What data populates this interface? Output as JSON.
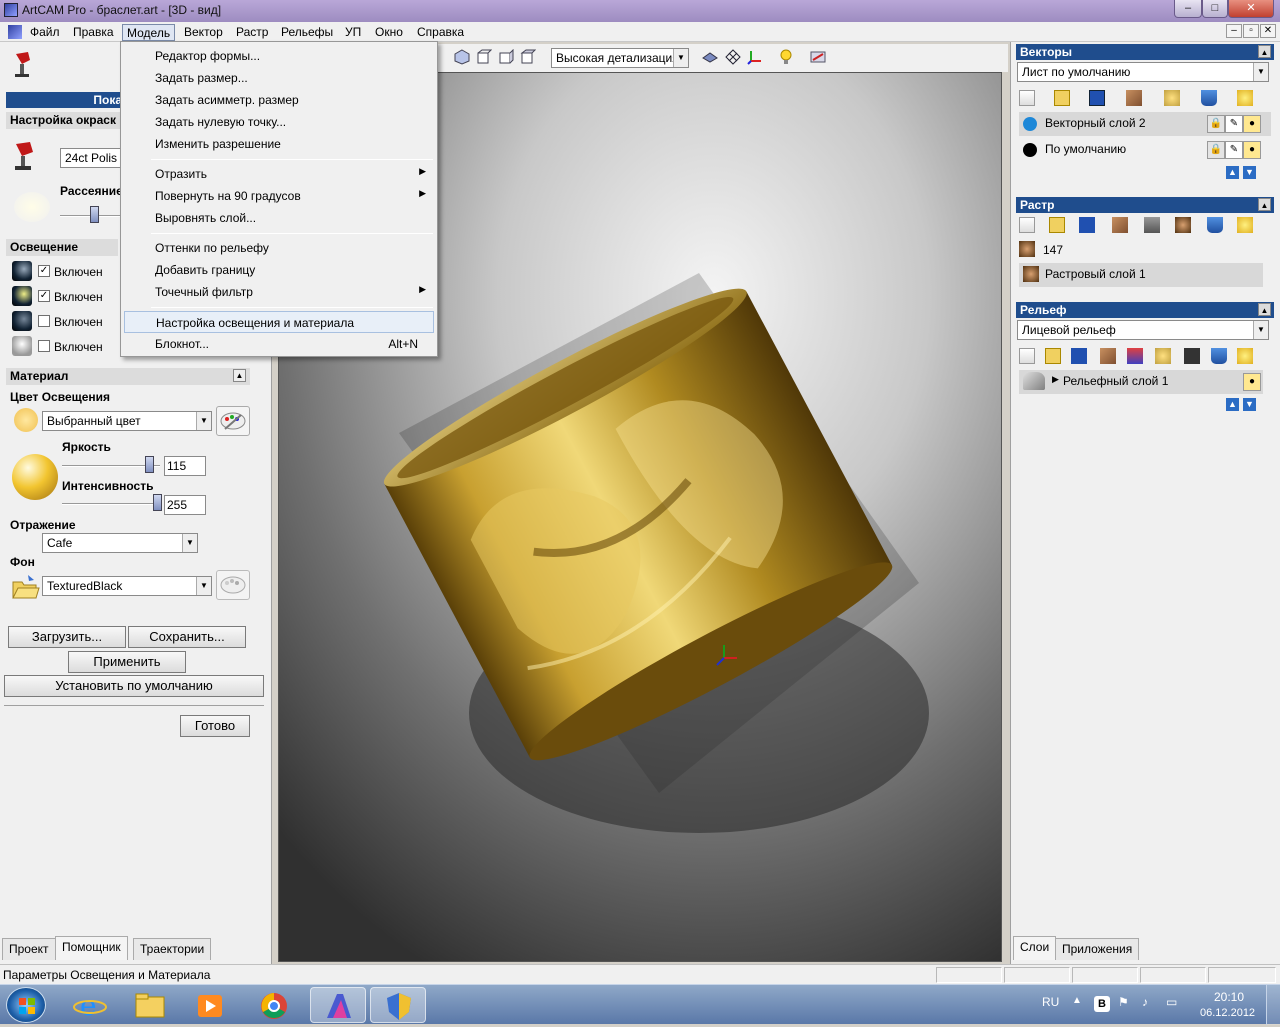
{
  "window": {
    "title": "ArtCAM Pro - браслет.art - [3D - вид]",
    "min": "–",
    "max": "□",
    "close": "✕"
  },
  "menubar": {
    "items": [
      "Файл",
      "Правка",
      "Модель",
      "Вектор",
      "Растр",
      "Рельефы",
      "УП",
      "Окно",
      "Справка"
    ],
    "active": "Модель"
  },
  "dropdown": {
    "items": [
      {
        "label": "Редактор формы...",
        "shortcut": "",
        "submenu": false
      },
      {
        "label": "Задать размер...",
        "shortcut": "",
        "submenu": false
      },
      {
        "label": "Задать асимметр. размер",
        "shortcut": "",
        "submenu": false
      },
      {
        "label": "Задать нулевую точку...",
        "shortcut": "",
        "submenu": false
      },
      {
        "label": "Изменить разрешение",
        "shortcut": "",
        "submenu": false
      },
      {
        "label": "Отразить",
        "shortcut": "",
        "submenu": true
      },
      {
        "label": "Повернуть на 90 градусов",
        "shortcut": "",
        "submenu": true
      },
      {
        "label": "Выровнять слой...",
        "shortcut": "",
        "submenu": false
      },
      {
        "label": "Оттенки по рельефу",
        "shortcut": "",
        "submenu": false
      },
      {
        "label": "Добавить границу",
        "shortcut": "",
        "submenu": false
      },
      {
        "label": "Точечный фильтр",
        "shortcut": "",
        "submenu": true
      },
      {
        "label": "Настройка освещения и материала",
        "shortcut": "",
        "submenu": false,
        "highlighted": true
      },
      {
        "label": "Блокнот...",
        "shortcut": "Alt+N",
        "submenu": false
      }
    ]
  },
  "left": {
    "header_partial": "Пока",
    "color_section": "Настройка окраск",
    "material_combo_partial": "24ct Polis",
    "scatter_label": "Рассеяние",
    "lighting_title": "Освещение",
    "lights": [
      {
        "label": "Включен",
        "checked": true
      },
      {
        "label": "Включен",
        "checked": true
      },
      {
        "label": "Включен",
        "checked": false
      },
      {
        "label": "Включен",
        "checked": false
      }
    ],
    "material_title": "Материал",
    "light_color_label": "Цвет Освещения",
    "color_combo": "Выбранный цвет",
    "brightness_label": "Яркость",
    "brightness_value": "115",
    "intensity_label": "Интенсивность",
    "intensity_value": "255",
    "reflection_label": "Отражение",
    "reflection_combo": "Cafe",
    "background_label": "Фон",
    "background_combo": "TexturedBlack",
    "load_btn": "Загрузить...",
    "save_btn": "Сохранить...",
    "apply_btn": "Применить",
    "default_btn": "Установить по умолчанию",
    "done_btn": "Готово",
    "tabs": [
      "Проект",
      "Помощник",
      "Траектории"
    ],
    "selected_tab": "Помощник"
  },
  "toolbar3d": {
    "detail_combo": "Высокая детализация"
  },
  "right": {
    "vectors_title": "Векторы",
    "vectors_combo": "Лист по умолчанию",
    "vector_layers": [
      {
        "name": "Векторный слой 2",
        "color": "#1e88d8"
      },
      {
        "name": "По умолчанию",
        "color": "#000000"
      }
    ],
    "raster_title": "Растр",
    "raster_value": "147",
    "raster_layer": "Растровый слой 1",
    "relief_title": "Рельеф",
    "relief_combo": "Лицевой рельеф",
    "relief_layer": "Рельефный слой 1",
    "tabs": [
      "Слои",
      "Приложения"
    ],
    "selected_tab": "Слои"
  },
  "statusbar": {
    "text": "Параметры Освещения и Материала"
  },
  "taskbar": {
    "lang": "RU",
    "time": "20:10",
    "date": "06.12.2012",
    "apps": [
      "start-orb",
      "internet-explorer",
      "file-explorer",
      "media-player",
      "chrome",
      "artcam",
      "security-center"
    ]
  }
}
